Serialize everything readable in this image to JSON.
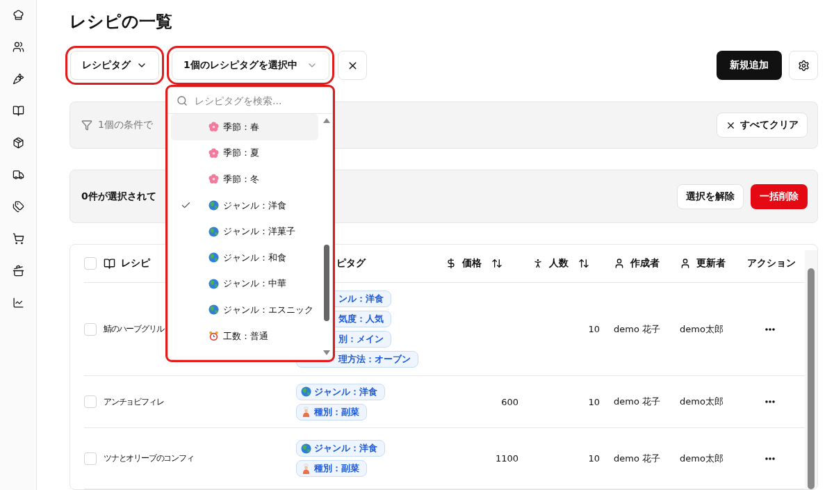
{
  "page_title": "レシピの一覧",
  "toolbar": {
    "tag_filter": {
      "label": "レシピタグ"
    },
    "selected_tags": {
      "label": "1個のレシピタグを選択中"
    },
    "add_button": "新規追加"
  },
  "dropdown": {
    "search": {
      "placeholder": "レシピタグを検索..."
    },
    "items": [
      {
        "kind": "season",
        "label": "季節：春",
        "checked": false,
        "highlighted": true
      },
      {
        "kind": "season",
        "label": "季節：夏",
        "checked": false,
        "highlighted": false
      },
      {
        "kind": "season",
        "label": "季節：冬",
        "checked": false,
        "highlighted": false
      },
      {
        "kind": "genre",
        "label": "ジャンル：洋食",
        "checked": true,
        "highlighted": false
      },
      {
        "kind": "genre",
        "label": "ジャンル：洋菓子",
        "checked": false,
        "highlighted": false
      },
      {
        "kind": "genre",
        "label": "ジャンル：和食",
        "checked": false,
        "highlighted": false
      },
      {
        "kind": "genre",
        "label": "ジャンル：中華",
        "checked": false,
        "highlighted": false
      },
      {
        "kind": "genre",
        "label": "ジャンル：エスニック",
        "checked": false,
        "highlighted": false
      },
      {
        "kind": "effort",
        "label": "工数：普通",
        "checked": false,
        "highlighted": false
      }
    ]
  },
  "filter_bar": {
    "text": "1個の条件で",
    "clear_all": "すべてクリア"
  },
  "selection_bar": {
    "text": "0件が選択されて",
    "deselect": "選択を解除",
    "bulk_delete": "一括削除"
  },
  "table": {
    "select_all_checked": false,
    "columns": [
      {
        "kind": "recipe",
        "label": "レシピ"
      },
      {
        "kind": "tags",
        "label": "ピタグ"
      },
      {
        "kind": "price",
        "label": "価格"
      },
      {
        "kind": "people",
        "label": "人数"
      },
      {
        "kind": "creator",
        "label": "作成者"
      },
      {
        "kind": "updater",
        "label": "更新者"
      },
      {
        "kind": "action",
        "label": "アクション"
      }
    ],
    "rows": [
      {
        "checked": false,
        "name": "鯖のハーブグリル",
        "tags": [
          {
            "kind": "clipped",
            "label": "ンル：洋食"
          },
          {
            "kind": "clipped",
            "label": "気度：人気"
          },
          {
            "kind": "clipped",
            "label": "別：メイン"
          },
          {
            "kind": "clipped",
            "label": "理方法：オーブン"
          }
        ],
        "price": "",
        "people": "10",
        "creator": "demo 花子",
        "updater": "demo太郎"
      },
      {
        "checked": false,
        "name": "アンチョビフィレ",
        "tags": [
          {
            "kind": "genre",
            "label": "ジャンル：洋食"
          },
          {
            "kind": "dish_type",
            "label": "種別：副菜"
          }
        ],
        "price": "600",
        "people": "10",
        "creator": "demo 花子",
        "updater": "demo太郎"
      },
      {
        "checked": false,
        "name": "ツナとオリーブのコンフィ",
        "tags": [
          {
            "kind": "genre",
            "label": "ジャンル：洋食"
          },
          {
            "kind": "dish_type",
            "label": "種別：副菜"
          }
        ],
        "price": "1100",
        "people": "10",
        "creator": "demo 花子",
        "updater": "demo太郎"
      }
    ]
  }
}
